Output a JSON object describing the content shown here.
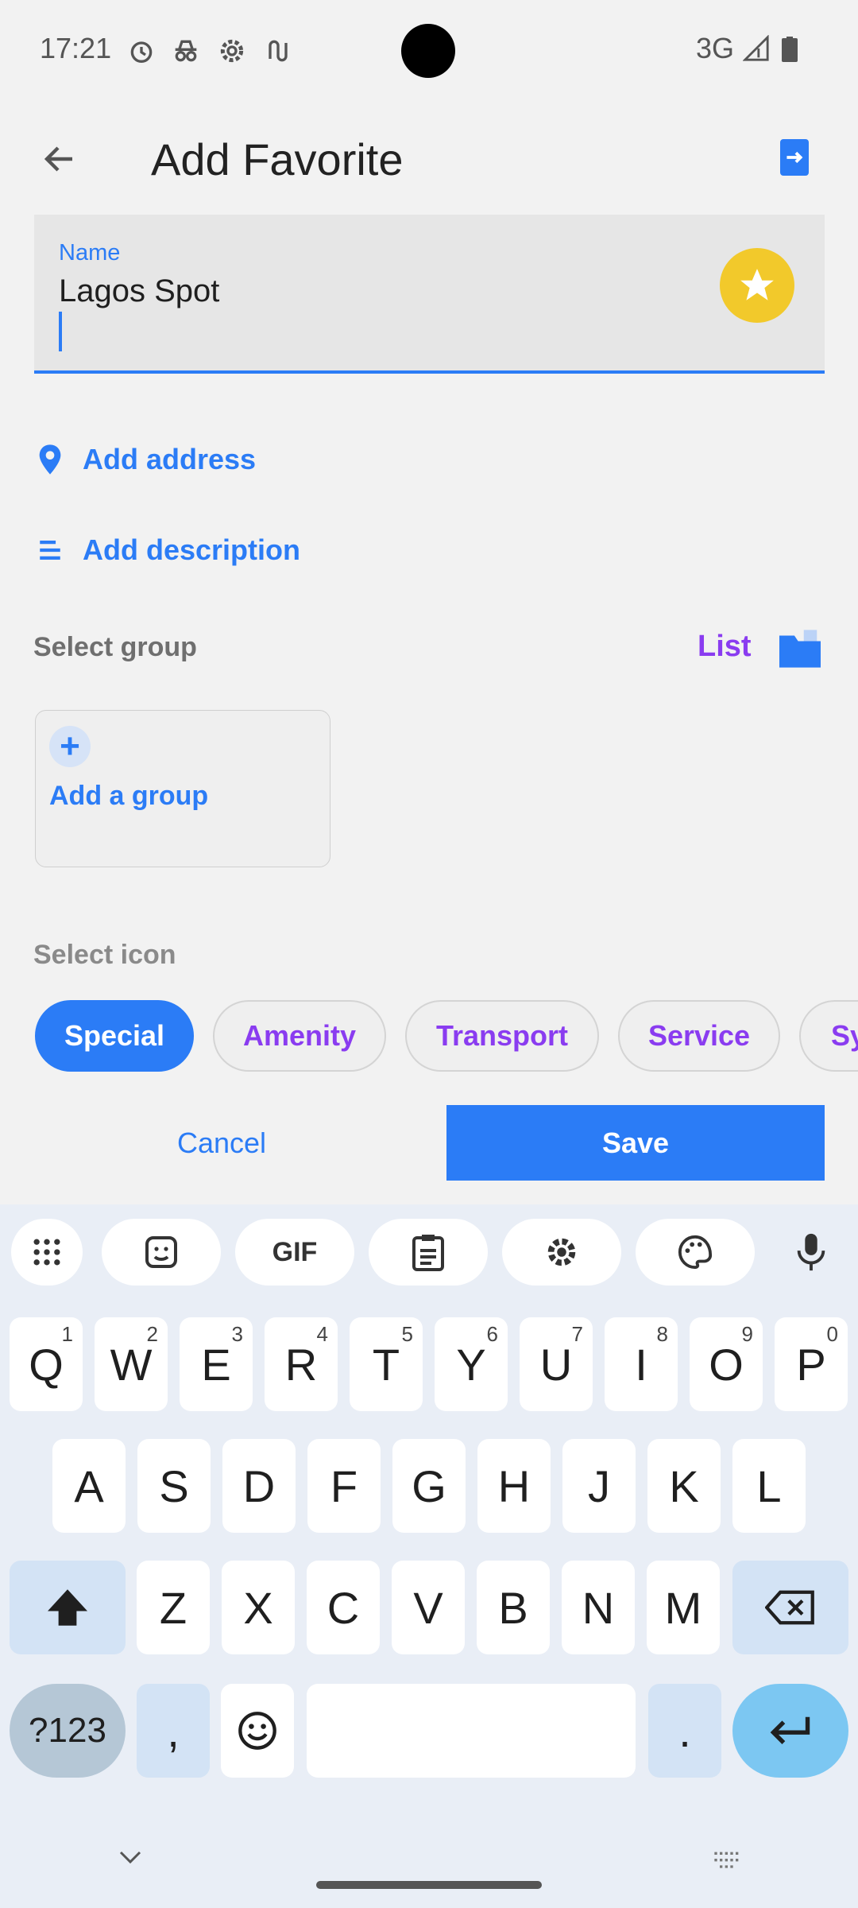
{
  "status_bar": {
    "time": "17:21",
    "network": "3G"
  },
  "app_bar": {
    "title": "Add Favorite"
  },
  "name_field": {
    "label": "Name",
    "value": "Lagos Spot"
  },
  "links": {
    "add_address": "Add address",
    "add_description": "Add description"
  },
  "group": {
    "placeholder": "Select group",
    "list_label": "List",
    "add_group": "Add a group"
  },
  "icon_section": {
    "placeholder": "Select icon",
    "chips": [
      "Special",
      "Amenity",
      "Transport",
      "Service",
      "Sy"
    ],
    "selected": "Special"
  },
  "actions": {
    "cancel": "Cancel",
    "save": "Save"
  },
  "keyboard": {
    "row1": [
      {
        "k": "Q",
        "h": "1"
      },
      {
        "k": "W",
        "h": "2"
      },
      {
        "k": "E",
        "h": "3"
      },
      {
        "k": "R",
        "h": "4"
      },
      {
        "k": "T",
        "h": "5"
      },
      {
        "k": "Y",
        "h": "6"
      },
      {
        "k": "U",
        "h": "7"
      },
      {
        "k": "I",
        "h": "8"
      },
      {
        "k": "O",
        "h": "9"
      },
      {
        "k": "P",
        "h": "0"
      }
    ],
    "row2": [
      "A",
      "S",
      "D",
      "F",
      "G",
      "H",
      "J",
      "K",
      "L"
    ],
    "row3": [
      "Z",
      "X",
      "C",
      "V",
      "B",
      "N",
      "M"
    ],
    "symbols_key": "?123",
    "comma": ",",
    "period": ".",
    "gif": "GIF"
  },
  "colors": {
    "accent": "#2b7cf6",
    "chip_text": "#8a3cf0",
    "star": "#f2c92b"
  }
}
